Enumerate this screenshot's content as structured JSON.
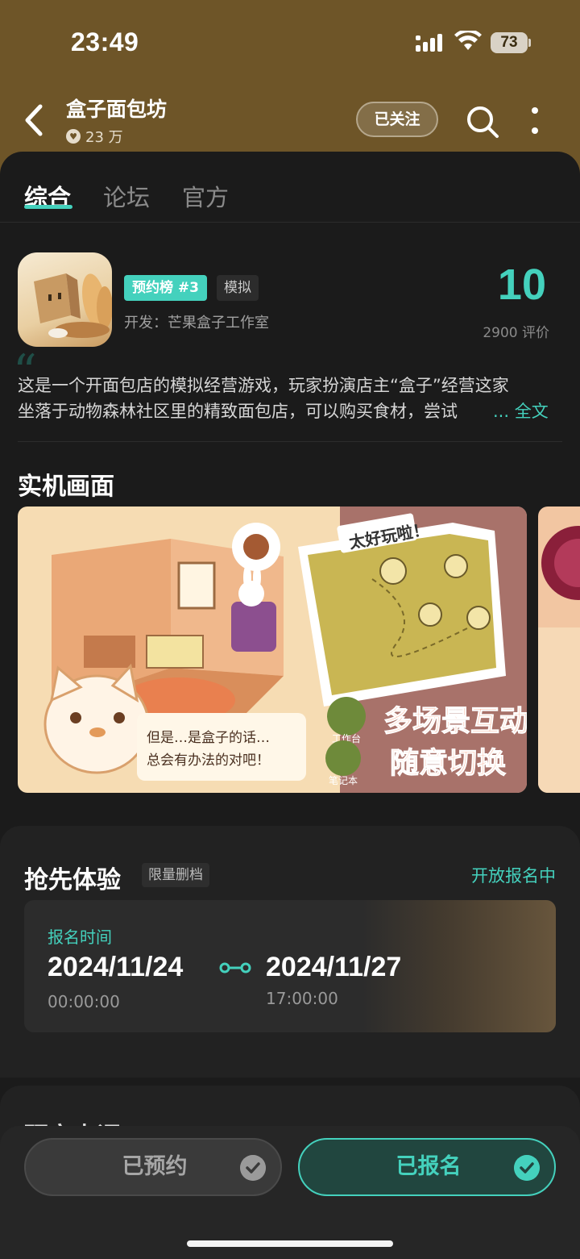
{
  "status_bar": {
    "time": "23:49",
    "battery": "73"
  },
  "header": {
    "title": "盒子面包坊",
    "followers": "23 万",
    "follow_label": "已关注"
  },
  "tabs": [
    {
      "label": "综合",
      "active": true
    },
    {
      "label": "论坛",
      "active": false
    },
    {
      "label": "官方",
      "active": false
    }
  ],
  "game": {
    "rank_badge": "预约榜 #3",
    "genre": "模拟",
    "developer": "开发：芒果盒子工作室",
    "score": "10",
    "review_count": "2900 评价",
    "description_line1": "这是一个开面包店的模拟经营游戏，玩家扮演店主“盒子”经营这家",
    "description_line2": "坐落于动物森林社区里的精致面包店，可以购买食材，尝试",
    "full_text_link": "... 全文"
  },
  "screenshots": {
    "section_title": "实机画面",
    "shot1_texts": {
      "speech": "但是…是盒子的话…",
      "speech2": "总会有办法的对吧！",
      "sticker": "太好玩啦！",
      "slogan1": "多场景互动",
      "slogan2": "随意切换",
      "icon1": "工作台",
      "icon2": "笔记本"
    }
  },
  "early_access": {
    "title": "抢先体验",
    "tag": "限量删档",
    "status": "开放报名中",
    "reg_label": "报名时间",
    "start_date": "2024/11/24",
    "start_time": "00:00:00",
    "end_date": "2024/11/27",
    "end_time": "17:00:00"
  },
  "next_section": {
    "title": "研究点评"
  },
  "bottom": {
    "reserved_label": "已预约",
    "signed_label": "已报名"
  },
  "colors": {
    "accent": "#44d1bd",
    "header_bg": "#6e5528",
    "page_bg": "#1b1b1b"
  }
}
